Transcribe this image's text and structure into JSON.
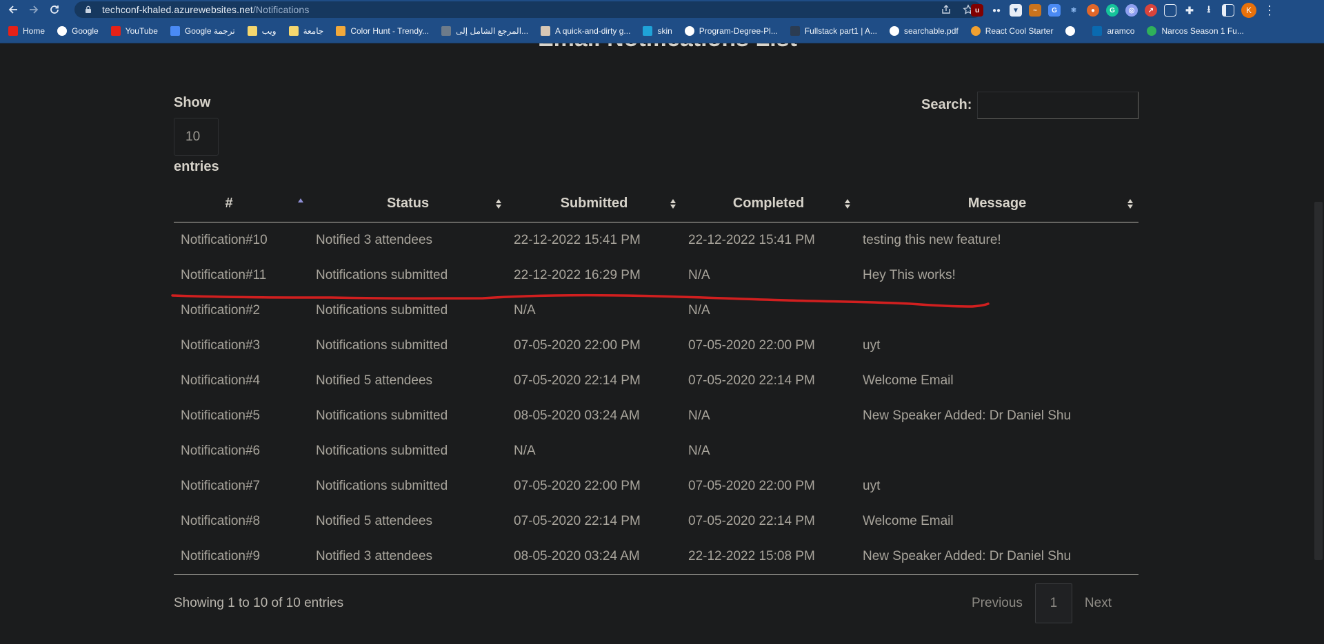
{
  "browser": {
    "url_host": "techconf-khaled.azurewebsites.net",
    "url_path": "/Notifications",
    "avatar_letter": "K",
    "accent": "#1f4d86",
    "bookmarks": [
      {
        "label": "Home",
        "color": "#e62117",
        "icon": "youtube-icon"
      },
      {
        "label": "Google",
        "color": "#ffffff",
        "icon": "google-icon"
      },
      {
        "label": "YouTube",
        "color": "#e62117",
        "icon": "youtube-icon"
      },
      {
        "label": "Google ترجمة",
        "color": "#4a8af4",
        "icon": "translate-icon"
      },
      {
        "label": "ويب",
        "color": "#f5d76e",
        "icon": "folder-icon"
      },
      {
        "label": "جامعة",
        "color": "#f5d76e",
        "icon": "folder-icon"
      },
      {
        "label": "Color Hunt - Trendy...",
        "color": "#f2a93b",
        "icon": "colorhunt-icon"
      },
      {
        "label": "المرجع الشامل إلى...",
        "color": "#6d7b8a",
        "icon": "page-icon"
      },
      {
        "label": "A quick-and-dirty g...",
        "color": "#d7c7b5",
        "icon": "page-icon"
      },
      {
        "label": "skin",
        "color": "#1fa3d8",
        "icon": "tl-icon"
      },
      {
        "label": "Program-Degree-Pl...",
        "color": "#ffffff",
        "icon": "globe-icon"
      },
      {
        "label": "Fullstack part1 | A...",
        "color": "#2b3c52",
        "icon": "page-icon"
      },
      {
        "label": "searchable.pdf",
        "color": "#ffffff",
        "icon": "globe-icon"
      },
      {
        "label": "React Cool Starter",
        "color": "#f0a030",
        "icon": "emoji-icon"
      },
      {
        "label": "",
        "color": "#ffffff",
        "icon": "globe-icon"
      },
      {
        "label": "aramco",
        "color": "#0a6ab0",
        "icon": "sap-icon"
      },
      {
        "label": "Narcos Season 1 Fu...",
        "color": "#2fb05a",
        "icon": "play-icon"
      }
    ]
  },
  "page": {
    "title": "Email Notifications List",
    "show_label": "Show",
    "entries_label": "entries",
    "page_length": "10",
    "search_label": "Search:",
    "search_value": "",
    "columns": [
      "#",
      "Status",
      "Submitted",
      "Completed",
      "Message"
    ],
    "rows": [
      [
        "Notification#10",
        "Notified 3 attendees",
        "22-12-2022 15:41 PM",
        "22-12-2022 15:41 PM",
        "testing this new feature!"
      ],
      [
        "Notification#11",
        "Notifications submitted",
        "22-12-2022 16:29 PM",
        "N/A",
        "Hey This works!"
      ],
      [
        "Notification#2",
        "Notifications submitted",
        "N/A",
        "N/A",
        ""
      ],
      [
        "Notification#3",
        "Notifications submitted",
        "07-05-2020 22:00 PM",
        "07-05-2020 22:00 PM",
        "uyt"
      ],
      [
        "Notification#4",
        "Notified 5 attendees",
        "07-05-2020 22:14 PM",
        "07-05-2020 22:14 PM",
        "Welcome Email"
      ],
      [
        "Notification#5",
        "Notifications submitted",
        "08-05-2020 03:24 AM",
        "N/A",
        "New Speaker Added: Dr Daniel Shu"
      ],
      [
        "Notification#6",
        "Notifications submitted",
        "N/A",
        "N/A",
        ""
      ],
      [
        "Notification#7",
        "Notifications submitted",
        "07-05-2020 22:00 PM",
        "07-05-2020 22:00 PM",
        "uyt"
      ],
      [
        "Notification#8",
        "Notified 5 attendees",
        "07-05-2020 22:14 PM",
        "07-05-2020 22:14 PM",
        "Welcome Email"
      ],
      [
        "Notification#9",
        "Notified 3 attendees",
        "08-05-2020 03:24 AM",
        "22-12-2022 15:08 PM",
        "New Speaker Added: Dr Daniel Shu"
      ]
    ],
    "info": "Showing 1 to 10 of 10 entries",
    "pagination": {
      "previous": "Previous",
      "current": "1",
      "next": "Next"
    },
    "annotation_color": "#d11f1f"
  }
}
